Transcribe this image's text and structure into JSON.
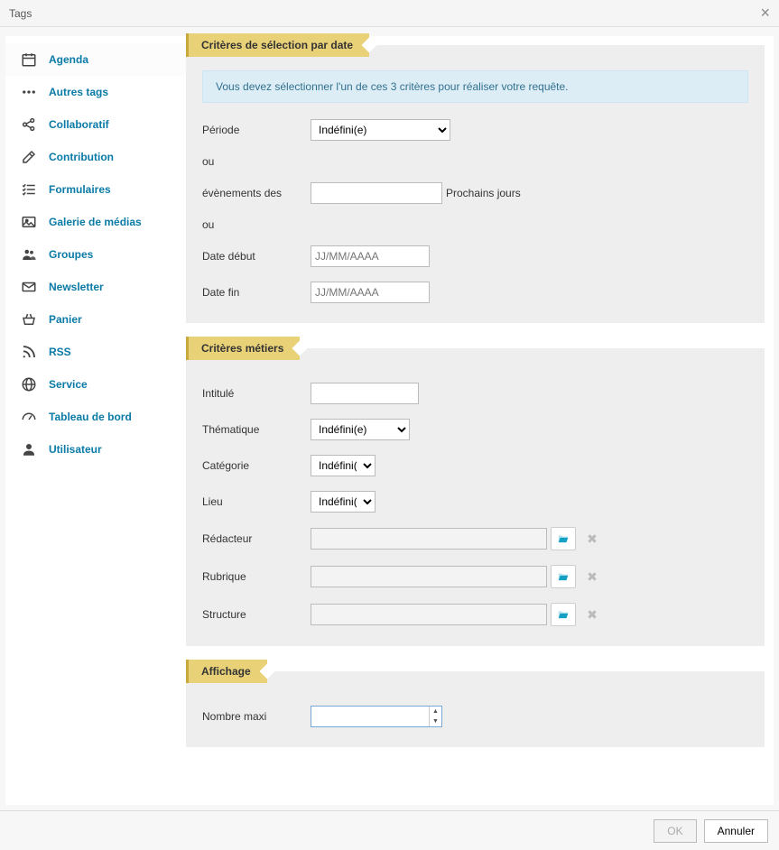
{
  "header": {
    "title": "Tags"
  },
  "sidebar": {
    "items": [
      {
        "label": "Agenda",
        "icon": "calendar"
      },
      {
        "label": "Autres tags",
        "icon": "dots"
      },
      {
        "label": "Collaboratif",
        "icon": "share"
      },
      {
        "label": "Contribution",
        "icon": "edit"
      },
      {
        "label": "Formulaires",
        "icon": "checklist"
      },
      {
        "label": "Galerie de médias",
        "icon": "gallery"
      },
      {
        "label": "Groupes",
        "icon": "group"
      },
      {
        "label": "Newsletter",
        "icon": "envelope"
      },
      {
        "label": "Panier",
        "icon": "basket"
      },
      {
        "label": "RSS",
        "icon": "rss"
      },
      {
        "label": "Service",
        "icon": "globe"
      },
      {
        "label": "Tableau de bord",
        "icon": "gauge"
      },
      {
        "label": "Utilisateur",
        "icon": "user"
      }
    ]
  },
  "sections": {
    "date": {
      "title": "Critères de sélection par date",
      "info": "Vous devez sélectionner l'un de ces 3 critères pour réaliser votre requête.",
      "period_label": "Période",
      "period_value": "Indéfini(e)",
      "or": "ou",
      "events_label": "évènements des",
      "events_suffix": "Prochains jours",
      "date_start_label": "Date début",
      "date_end_label": "Date fin",
      "date_placeholder": "JJ/MM/AAAA"
    },
    "metiers": {
      "title": "Critères métiers",
      "intitule_label": "Intitulé",
      "thematique_label": "Thématique",
      "thematique_value": "Indéfini(e)",
      "categorie_label": "Catégorie",
      "categorie_value": "Indéfini(e)",
      "lieu_label": "Lieu",
      "lieu_value": "Indéfini(e)",
      "redacteur_label": "Rédacteur",
      "rubrique_label": "Rubrique",
      "structure_label": "Structure"
    },
    "affichage": {
      "title": "Affichage",
      "nombre_label": "Nombre maxi"
    }
  },
  "footer": {
    "ok": "OK",
    "cancel": "Annuler"
  }
}
